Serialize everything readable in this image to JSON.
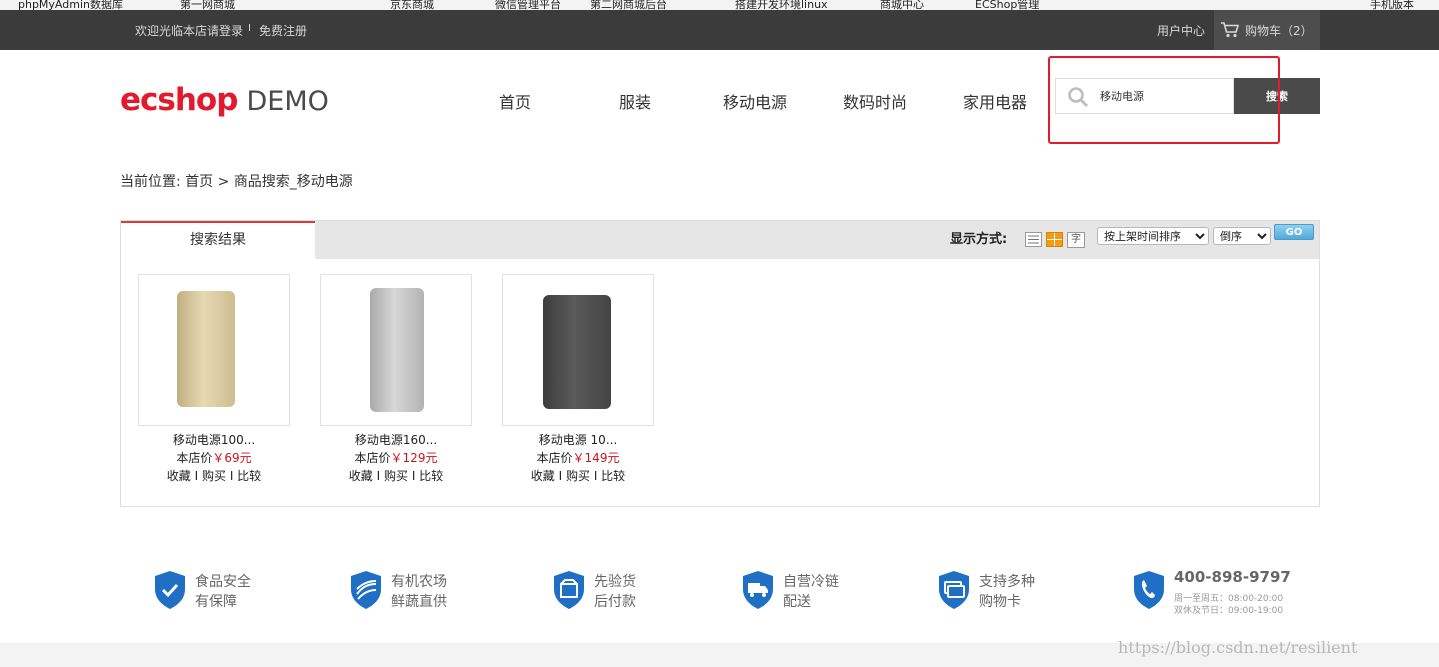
{
  "bookmarks": [
    "phpMyAdmin数据库",
    "第一网商城",
    "京东商城",
    "微信管理平台",
    "第二网商城后台",
    "搭建开发环境linux",
    "商城中心",
    "ECShop管理",
    "手机版本"
  ],
  "topbar": {
    "welcome": "欢迎光临本店",
    "login": "请登录",
    "separator": "I",
    "register": "免费注册",
    "user_center": "用户中心",
    "cart": "购物车（2）"
  },
  "header": {
    "logo_mark": "ecshop",
    "logo_text": "DEMO",
    "nav": [
      "首页",
      "服装",
      "移动电源",
      "数码时尚",
      "家用电器"
    ],
    "search_value": "移动电源",
    "search_button": "搜索"
  },
  "breadcrumb": {
    "label": "当前位置: ",
    "home": "首页",
    "sep": " > ",
    "current": "商品搜索_移动电源"
  },
  "results": {
    "tab": "搜索结果",
    "display_label": "显示方式:",
    "view_modes": [
      "list",
      "grid",
      "text"
    ],
    "sort_by": "按上架时间排序",
    "order": "倒序",
    "go": "GO",
    "products": [
      {
        "name": "移动电源100...",
        "price_label": "本店价",
        "price": "￥69元",
        "color": "#d4c59e",
        "actions": [
          "收藏",
          "购买",
          "比较"
        ]
      },
      {
        "name": "移动电源160...",
        "price_label": "本店价",
        "price": "￥129元",
        "color": "#bdbdbd",
        "actions": [
          "收藏",
          "购买",
          "比较"
        ]
      },
      {
        "name": "移动电源 10...",
        "price_label": "本店价",
        "price": "￥149元",
        "color": "#4f4f4f",
        "actions": [
          "收藏",
          "购买",
          "比较"
        ]
      }
    ]
  },
  "features": [
    {
      "icon": "shield-check-icon",
      "line1": "食品安全",
      "line2": "有保障"
    },
    {
      "icon": "farm-icon",
      "line1": "有机农场",
      "line2": "鲜蔬直供"
    },
    {
      "icon": "package-icon",
      "line1": "先验货",
      "line2": "后付款"
    },
    {
      "icon": "truck-icon",
      "line1": "自营冷链",
      "line2": "配送"
    },
    {
      "icon": "card-icon",
      "line1": "支持多种",
      "line2": "购物卡"
    }
  ],
  "hotline": {
    "icon": "phone-icon",
    "phone": "400-898-9797",
    "hours1": "周一至周五：08:00-20:00",
    "hours2": "双休及节日：09:00-19:00"
  },
  "watermark": "https://blog.csdn.net/resilient",
  "colors": {
    "accent_red": "#e31a2b",
    "price_red": "#c8161d",
    "topbar": "#3b3b3b",
    "shield_blue": "#1f6fc5"
  }
}
